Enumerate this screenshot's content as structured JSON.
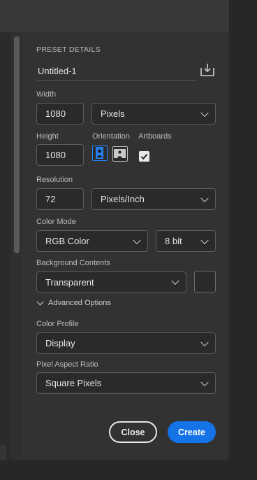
{
  "colors": {
    "accent": "#1473e6",
    "background": "#323232",
    "field": "#2a2a2a"
  },
  "preset": {
    "section_title": "PRESET DETAILS",
    "name_value": "Untitled-1",
    "save_icon": "save-preset-icon"
  },
  "width": {
    "label": "Width",
    "value": "1080",
    "unit": "Pixels"
  },
  "height": {
    "label": "Height",
    "value": "1080"
  },
  "orientation": {
    "label": "Orientation",
    "options": [
      "portrait",
      "landscape"
    ],
    "selected": "portrait"
  },
  "artboards": {
    "label": "Artboards",
    "checked": true
  },
  "resolution": {
    "label": "Resolution",
    "value": "72",
    "unit": "Pixels/Inch"
  },
  "color_mode": {
    "label": "Color Mode",
    "mode": "RGB Color",
    "depth": "8 bit"
  },
  "background": {
    "label": "Background Contents",
    "value": "Transparent"
  },
  "advanced": {
    "label": "Advanced Options",
    "expanded": true
  },
  "color_profile": {
    "label": "Color Profile",
    "value": "Display"
  },
  "pixel_aspect": {
    "label": "Pixel Aspect Ratio",
    "value": "Square Pixels"
  },
  "buttons": {
    "close": "Close",
    "create": "Create"
  }
}
